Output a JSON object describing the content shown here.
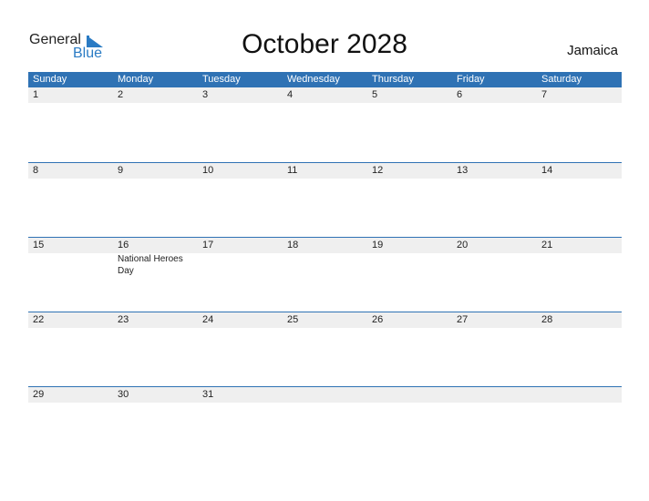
{
  "logo": {
    "word1": "General",
    "word2": "Blue",
    "icon": "triangle-flag-icon"
  },
  "title": "October 2028",
  "country": "Jamaica",
  "colors": {
    "header": "#2f72b4",
    "accent": "#2a7bc4",
    "strip": "#efefef"
  },
  "days": [
    "Sunday",
    "Monday",
    "Tuesday",
    "Wednesday",
    "Thursday",
    "Friday",
    "Saturday"
  ],
  "weeks": [
    {
      "dates": [
        "1",
        "2",
        "3",
        "4",
        "5",
        "6",
        "7"
      ]
    },
    {
      "dates": [
        "8",
        "9",
        "10",
        "11",
        "12",
        "13",
        "14"
      ]
    },
    {
      "dates": [
        "15",
        "16",
        "17",
        "18",
        "19",
        "20",
        "21"
      ]
    },
    {
      "dates": [
        "22",
        "23",
        "24",
        "25",
        "26",
        "27",
        "28"
      ]
    },
    {
      "dates": [
        "29",
        "30",
        "31",
        "",
        "",
        "",
        ""
      ]
    }
  ],
  "events": [
    {
      "date": "16",
      "label": "National Heroes Day"
    }
  ]
}
